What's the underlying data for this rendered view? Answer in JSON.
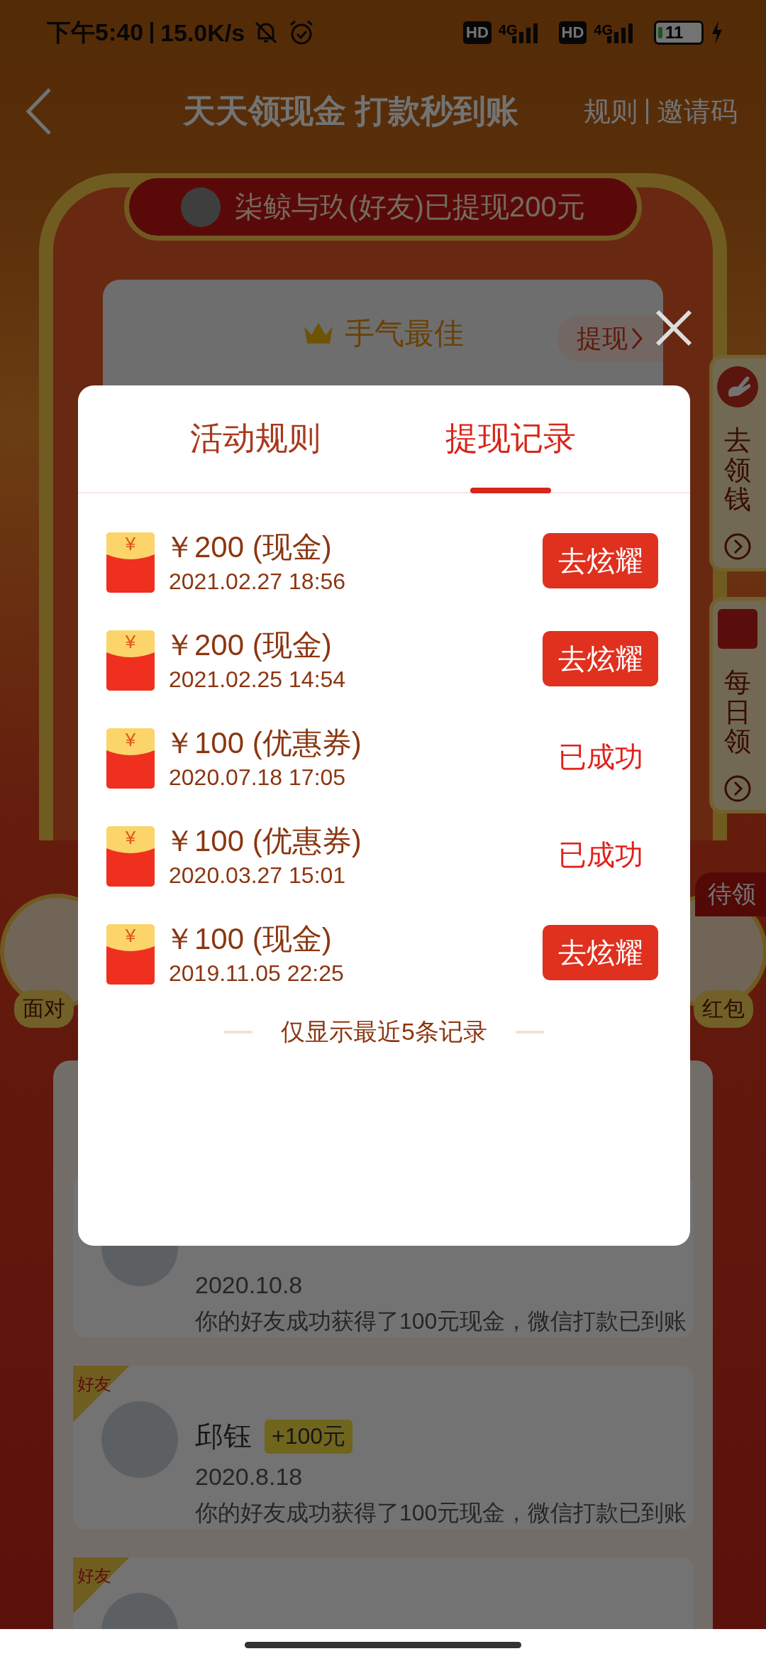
{
  "status_bar": {
    "time": "下午5:40",
    "speed": "15.0K/s",
    "sims": [
      {
        "hd": "HD",
        "network": "4G"
      },
      {
        "hd": "HD",
        "network": "4G"
      }
    ],
    "battery": "11"
  },
  "header": {
    "title": "天天领现金 打款秒到账",
    "links": [
      "规则",
      "邀请码"
    ]
  },
  "banner": {
    "text": "柒鲸与玖(好友)已提现200元"
  },
  "best_card": {
    "title": "手气最佳",
    "withdraw": "提现"
  },
  "side_tabs": [
    {
      "label": "去领钱",
      "kind": "hand"
    },
    {
      "label": "每日领",
      "kind": "box"
    }
  ],
  "pending_tag": "待领",
  "shortcuts": [
    "面对",
    "红包"
  ],
  "friends": [
    {
      "date": "2020.10.8",
      "message": "你的好友成功获得了100元现金，微信打款已到账"
    },
    {
      "tag": "好友",
      "name": "邱钰",
      "bonus": "+100元",
      "date": "2020.8.18",
      "message": "你的好友成功获得了100元现金，微信打款已到账"
    },
    {
      "tag": "好友"
    }
  ],
  "modal": {
    "tabs": [
      {
        "label": "活动规则",
        "selected": false
      },
      {
        "label": "提现记录",
        "selected": true
      }
    ],
    "records": [
      {
        "mark": "¥",
        "amount": "￥200 (现金)",
        "time": "2021.02.27 18:56",
        "action": {
          "kind": "button",
          "label": "去炫耀"
        }
      },
      {
        "mark": "¥",
        "amount": "￥200 (现金)",
        "time": "2021.02.25 14:54",
        "action": {
          "kind": "button",
          "label": "去炫耀"
        }
      },
      {
        "mark": "¥",
        "amount": "￥100 (优惠券)",
        "time": "2020.07.18 17:05",
        "action": {
          "kind": "status",
          "label": "已成功"
        }
      },
      {
        "mark": "¥",
        "amount": "￥100 (优惠券)",
        "time": "2020.03.27 15:01",
        "action": {
          "kind": "status",
          "label": "已成功"
        }
      },
      {
        "mark": "¥",
        "amount": "￥100 (现金)",
        "time": "2019.11.05 22:25",
        "action": {
          "kind": "button",
          "label": "去炫耀"
        }
      }
    ],
    "note": "仅显示最近5条记录"
  }
}
